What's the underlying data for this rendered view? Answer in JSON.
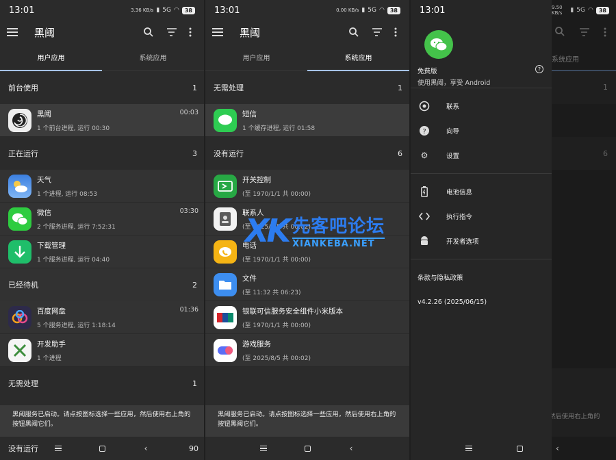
{
  "status": {
    "time": "13:01",
    "speed_1": "3.36 KB/s",
    "speed_2": "0.00 KB/s",
    "speed_3": "9.50 KB/s",
    "network": "5G",
    "battery": "38"
  },
  "app": {
    "title": "黑阈",
    "tabs": [
      "用户应用",
      "系统应用"
    ]
  },
  "panel1": {
    "sections": [
      {
        "label": "前台使用",
        "count": "1"
      },
      {
        "label": "正在运行",
        "count": "3"
      },
      {
        "label": "已经待机",
        "count": "2"
      },
      {
        "label": "无需处理",
        "count": "1"
      }
    ],
    "rows": [
      {
        "name": "黑阈",
        "time": "00:03",
        "sub": "1 个前台进程, 运行 00:30",
        "icon": "heiyu-icon"
      },
      {
        "name": "天气",
        "time": "",
        "sub": "1 个进程, 运行 08:53",
        "icon": "weather-icon"
      },
      {
        "name": "微信",
        "time": "03:30",
        "sub": "2 个服务进程, 运行 7:52:31",
        "icon": "wechat-icon"
      },
      {
        "name": "下载管理",
        "time": "",
        "sub": "1 个服务进程, 运行 04:40",
        "icon": "download-icon"
      },
      {
        "name": "百度网盘",
        "time": "01:36",
        "sub": "5 个服务进程, 运行 1:18:14",
        "icon": "baidu-netdisk-icon"
      },
      {
        "name": "开发助手",
        "time": "",
        "sub": "1 个进程",
        "icon": "dev-tools-icon"
      }
    ],
    "bottom_label": "没有运行",
    "bottom_count": "90"
  },
  "panel2": {
    "sections": [
      {
        "label": "无需处理",
        "count": "1"
      },
      {
        "label": "没有运行",
        "count": "6"
      }
    ],
    "rows": [
      {
        "name": "短信",
        "time": "",
        "sub": "1 个缓存进程, 运行 01:58",
        "icon": "sms-icon"
      },
      {
        "name": "开关控制",
        "time": "",
        "sub": "(至 1970/1/1 共 00:00)",
        "icon": "switch-control-icon"
      },
      {
        "name": "联系人",
        "time": "",
        "sub": "(至 2025/8/5 共 00:02)",
        "icon": "contacts-icon"
      },
      {
        "name": "电话",
        "time": "",
        "sub": "(至 1970/1/1 共 00:00)",
        "icon": "phone-icon"
      },
      {
        "name": "文件",
        "time": "",
        "sub": "(至 11:32 共 06:23)",
        "icon": "files-icon"
      },
      {
        "name": "银联可信服务安全组件小米版本",
        "time": "",
        "sub": "(至 1970/1/1 共 00:00)",
        "icon": "unionpay-icon"
      },
      {
        "name": "游戏服务",
        "time": "",
        "sub": "(至 2025/8/5 共 00:02)",
        "icon": "game-service-icon"
      }
    ]
  },
  "snackbar": {
    "line1": "黑阈服务已启动。请点按图标选择一些应用，然后使用右上角的",
    "line2": "按钮黑阈它们。",
    "partial": "然后使用右上角的"
  },
  "drawer": {
    "plan": "免费版",
    "slogan": "使用黑阈，享受 Android",
    "items_a": [
      {
        "label": "联系",
        "icon": "contact-icon"
      },
      {
        "label": "向导",
        "icon": "help-circle-icon"
      },
      {
        "label": "设置",
        "icon": "gear-icon"
      }
    ],
    "items_b": [
      {
        "label": "电池信息",
        "icon": "battery-icon"
      },
      {
        "label": "执行指令",
        "icon": "code-icon"
      },
      {
        "label": "开发者选项",
        "icon": "android-icon"
      }
    ],
    "terms": "条款与隐私政策",
    "version": "v4.2.26 (2025/06/15)",
    "scrim_tab": "系统应用",
    "scrim_count_1": "1",
    "scrim_count_2": "6"
  },
  "watermark": {
    "logo": "XK",
    "cn": "先客吧论坛",
    "en": "XIANKEBA.NET"
  }
}
